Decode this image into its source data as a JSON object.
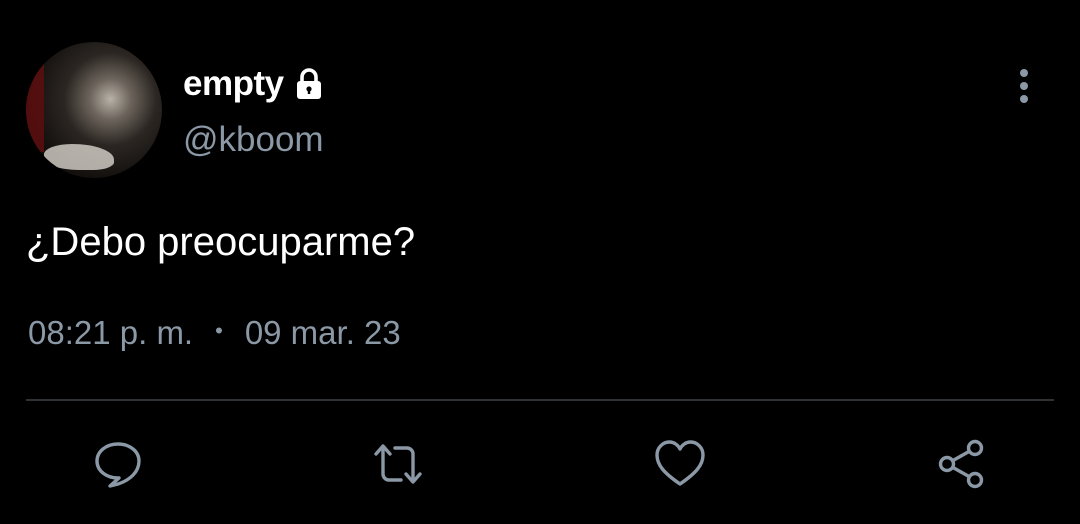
{
  "tweet": {
    "display_name": "empty",
    "handle": "@kboom",
    "protected_icon": "lock-icon",
    "text": "¿Debo preocuparme?",
    "time": "08:21 p. m.",
    "separator": "•",
    "date": "09 mar. 23"
  },
  "actions": {
    "reply_icon": "reply-icon",
    "retweet_icon": "retweet-icon",
    "like_icon": "heart-icon",
    "share_icon": "share-icon"
  },
  "colors": {
    "background": "#000000",
    "primary_text": "#ffffff",
    "secondary_text": "#8b98a5",
    "divider": "#2f3336"
  }
}
